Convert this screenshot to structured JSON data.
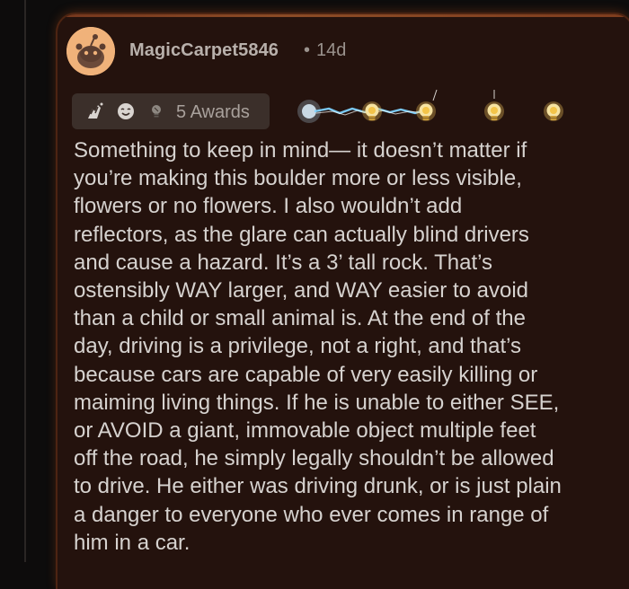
{
  "comment": {
    "author": "MagicCarpet5846",
    "separator": "•",
    "age": "14d",
    "awards_label": "5 Awards",
    "award_icons": [
      "hands-clap-award-icon",
      "wholesome-face-award-icon",
      "lightbulb-award-icon"
    ],
    "animated_awards": [
      "lightbulb-spark-icon",
      "lightbulb-icon",
      "lightbulb-icon",
      "lightbulb-icon"
    ],
    "body": "Something to keep in mind— it doesn’t matter if\nyou’re making this boulder more or less visible,\nflowers or no flowers. I also wouldn’t add\nreflectors, as the glare can actually blind drivers\nand cause a hazard. It’s a 3’ tall rock. That’s\nostensibly WAY larger, and WAY easier to avoid\nthan a child or small animal is. At the end of the\nday, driving is a privilege, not a right, and that’s\nbecause cars are capable of very easily killing or\nmaiming living things. If he is unable to either SEE,\nor AVOID a giant, immovable object multiple feet\noff the road, he simply legally shouldn’t be allowed\nto drive. He either was driving drunk, or is just plain\na danger to everyone who ever comes in range of\nhim in a car."
  },
  "colors": {
    "page_bg": "#0d0c0c",
    "card_bg": "#24120d",
    "card_glow": "#e07a3a",
    "avatar_bg": "#f0b27a",
    "text": "#d6d2cf",
    "muted": "#9a928d",
    "awards_bg": "#3b2f2a"
  }
}
